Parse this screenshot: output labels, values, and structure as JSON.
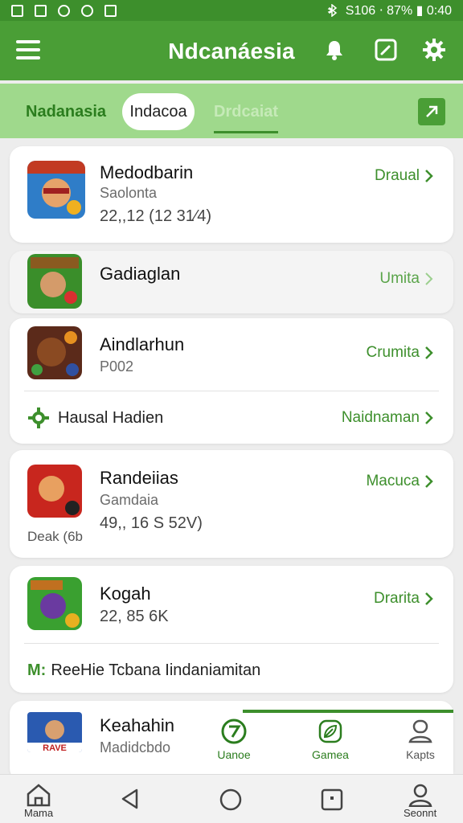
{
  "status_bar": {
    "left_icons": [
      "photo-icon",
      "photo-icon",
      "chrome-icon",
      "leaf-icon",
      "notification-icon"
    ],
    "text": "S106 ⋅ 87% ▮ 0:40"
  },
  "app_bar": {
    "title": "Ndcanáesia"
  },
  "tabs": [
    {
      "label": "Nadanasia"
    },
    {
      "label": "Indacoa"
    },
    {
      "label": "Drdcaiat"
    }
  ],
  "cards": [
    {
      "name": "Medodbarin",
      "sub": "Saolonta",
      "meta": "22,,12 (12 31⁄4)",
      "action": "Draual"
    },
    {
      "name": "Gadiaglan",
      "action": "Umita"
    },
    {
      "name": "Aindlarhun",
      "sub": "P002",
      "action": "Crumita",
      "row_label": "Hausal Hadien",
      "row_action": "Naidnaman"
    },
    {
      "name": "Randeiias",
      "sub": "Gamdaia",
      "meta": "49,, 16 S 52V)",
      "badge": "Deak (6b",
      "action": "Macuca"
    },
    {
      "name": "Kogah",
      "meta": "22, 85 6K",
      "action": "Drarita",
      "row_label": "ReeHie Tcbana Iindaniamitan",
      "row_prefix": "M:"
    },
    {
      "name": "Keahahin",
      "sub": "Madidcbdo",
      "icon_text": "RAVE"
    }
  ],
  "float_nav": [
    {
      "label": "Uanoe"
    },
    {
      "label": "Gamea"
    },
    {
      "label": "Kapts"
    }
  ],
  "system_nav": {
    "home": "Mama",
    "profile": "Seonnt"
  },
  "colors": {
    "primary": "#4a9e36",
    "dark": "#3d8f2c",
    "tab_bg": "#9fd98c"
  }
}
